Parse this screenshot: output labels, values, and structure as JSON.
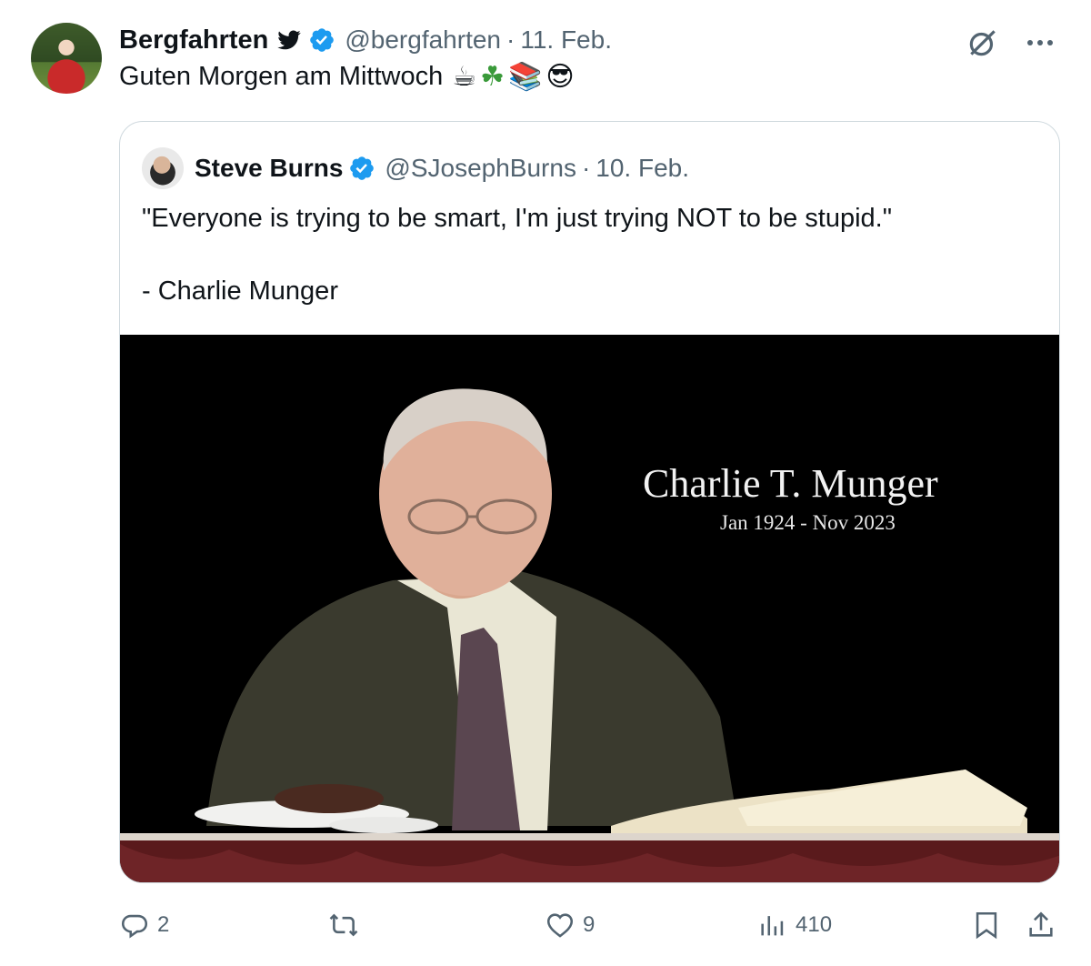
{
  "tweet": {
    "author_name": "Bergfahrten",
    "handle": "@bergfahrten",
    "separator": "·",
    "date": "11. Feb.",
    "text": "Guten Morgen am Mittwoch",
    "emojis": [
      "☕",
      "☘",
      "📚",
      "😎"
    ]
  },
  "quoted": {
    "author_name": "Steve Burns",
    "handle": "@SJosephBurns",
    "separator": "·",
    "date": "10. Feb.",
    "text": "\"Everyone is trying to be smart, I'm just trying NOT to be stupid.\"\n\n- Charlie Munger",
    "image": {
      "title": "Charlie T. Munger",
      "subtitle": "Jan 1924 - Nov 2023"
    }
  },
  "actions": {
    "replies": "2",
    "retweets": "",
    "likes": "9",
    "views": "410"
  },
  "icons": [
    "bird-icon",
    "verified-icon",
    "grok-icon",
    "more-icon",
    "reply-icon",
    "retweet-icon",
    "like-icon",
    "views-icon",
    "bookmark-icon",
    "share-icon"
  ],
  "colors": {
    "text": "#0f1419",
    "secondary": "#536471",
    "verified": "#1d9bf0",
    "border": "#cfd9de"
  }
}
